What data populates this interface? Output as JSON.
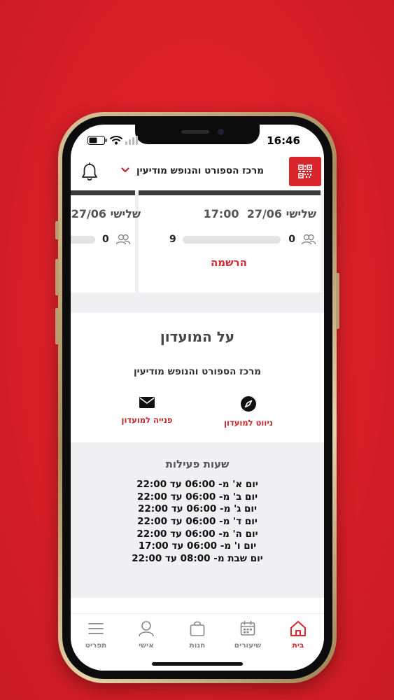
{
  "status_bar": {
    "time": "16:46"
  },
  "header": {
    "club_name": "מרכז הספורט והנופש מודיעין"
  },
  "cards": [
    {
      "date": "שלישי 27/06",
      "time": "17:00",
      "registered": "0",
      "capacity": "9",
      "action": "הרשמה"
    },
    {
      "date": "שלישי 27/06",
      "registered": "0"
    }
  ],
  "about": {
    "title": "על המועדון",
    "club_name": "מרכז הספורט והנופש מודיעין",
    "navigate_label": "ניווט למועדון",
    "contact_label": "פנייה למועדון"
  },
  "hours": {
    "title": "שעות פעילות",
    "rows": [
      "יום א' מ- 06:00  עד  22:00",
      "יום ב' מ- 06:00  עד  22:00",
      "יום ג' מ- 06:00  עד  22:00",
      "יום ד' מ- 06:00 עד 22:00",
      "יום ה' מ- 06:00 עד 22:00",
      "יום ו' מ- 06:00  עד  17:00",
      "יום שבת מ- 08:00 עד 22:00"
    ]
  },
  "tabs": [
    {
      "label": "בית",
      "icon": "home-icon",
      "active": true
    },
    {
      "label": "שיעורים",
      "icon": "calendar-icon"
    },
    {
      "label": "חנות",
      "icon": "bag-icon"
    },
    {
      "label": "אישי",
      "icon": "user-icon"
    },
    {
      "label": "תפריט",
      "icon": "menu-icon"
    }
  ],
  "colors": {
    "brand_red": "#d8262c",
    "background_red": "#e0232a"
  }
}
